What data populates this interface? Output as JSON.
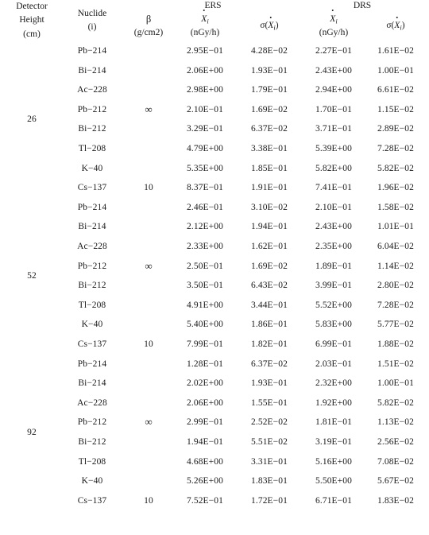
{
  "table": {
    "headers": {
      "detector_height": {
        "line1": "Detector",
        "line2": "Height",
        "line3": "(cm)"
      },
      "nuclide": {
        "line1": "Nuclide",
        "line2": "(i)"
      },
      "group_ers": "ERS",
      "group_drs": "DRS",
      "beta": {
        "symbol": "β",
        "unit": "(g/cm2)"
      },
      "xdot": {
        "var": "X",
        "sub": "i",
        "unit": "(nGy/h)"
      },
      "sigma": {
        "sigma": "σ",
        "open": "(",
        "var": "X",
        "sub": "i",
        "close": ")"
      }
    },
    "columns": [
      "Detector Height (cm)",
      "Nuclide (i)",
      "β (g/cm2)",
      "ERS Ẋi (nGy/h)",
      "ERS σ(Ẋi)",
      "DRS Ẋi (nGy/h)",
      "DRS σ(Ẋi)"
    ],
    "groups": [
      {
        "height": "26",
        "rows": [
          {
            "nuclide": "Pb−214",
            "beta": "",
            "ers_x": "2.95E−01",
            "ers_s": "4.28E−02",
            "drs_x": "2.27E−01",
            "drs_s": "1.61E−02"
          },
          {
            "nuclide": "Bi−214",
            "beta": "",
            "ers_x": "2.06E+00",
            "ers_s": "1.93E−01",
            "drs_x": "2.43E+00",
            "drs_s": "1.00E−01"
          },
          {
            "nuclide": "Ac−228",
            "beta": "",
            "ers_x": "2.98E+00",
            "ers_s": "1.79E−01",
            "drs_x": "2.94E+00",
            "drs_s": "6.61E−02"
          },
          {
            "nuclide": "Pb−212",
            "beta": "∞",
            "ers_x": "2.10E−01",
            "ers_s": "1.69E−02",
            "drs_x": "1.70E−01",
            "drs_s": "1.15E−02"
          },
          {
            "nuclide": "Bi−212",
            "beta": "",
            "ers_x": "3.29E−01",
            "ers_s": "6.37E−02",
            "drs_x": "3.71E−01",
            "drs_s": "2.89E−02"
          },
          {
            "nuclide": "Tl−208",
            "beta": "",
            "ers_x": "4.79E+00",
            "ers_s": "3.38E−01",
            "drs_x": "5.39E+00",
            "drs_s": "7.28E−02"
          },
          {
            "nuclide": "K−40",
            "beta": "",
            "ers_x": "5.35E+00",
            "ers_s": "1.85E−01",
            "drs_x": "5.82E+00",
            "drs_s": "5.82E−02"
          },
          {
            "nuclide": "Cs−137",
            "beta": "10",
            "ers_x": "8.37E−01",
            "ers_s": "1.91E−01",
            "drs_x": "7.41E−01",
            "drs_s": "1.96E−02"
          }
        ]
      },
      {
        "height": "52",
        "rows": [
          {
            "nuclide": "Pb−214",
            "beta": "",
            "ers_x": "2.46E−01",
            "ers_s": "3.10E−02",
            "drs_x": "2.10E−01",
            "drs_s": "1.58E−02"
          },
          {
            "nuclide": "Bi−214",
            "beta": "",
            "ers_x": "2.12E+00",
            "ers_s": "1.94E−01",
            "drs_x": "2.43E+00",
            "drs_s": "1.01E−01"
          },
          {
            "nuclide": "Ac−228",
            "beta": "",
            "ers_x": "2.33E+00",
            "ers_s": "1.62E−01",
            "drs_x": "2.35E+00",
            "drs_s": "6.04E−02"
          },
          {
            "nuclide": "Pb−212",
            "beta": "∞",
            "ers_x": "2.50E−01",
            "ers_s": "1.69E−02",
            "drs_x": "1.89E−01",
            "drs_s": "1.14E−02"
          },
          {
            "nuclide": "Bi−212",
            "beta": "",
            "ers_x": "3.50E−01",
            "ers_s": "6.43E−02",
            "drs_x": "3.99E−01",
            "drs_s": "2.80E−02"
          },
          {
            "nuclide": "Tl−208",
            "beta": "",
            "ers_x": "4.91E+00",
            "ers_s": "3.44E−01",
            "drs_x": "5.52E+00",
            "drs_s": "7.28E−02"
          },
          {
            "nuclide": "K−40",
            "beta": "",
            "ers_x": "5.40E+00",
            "ers_s": "1.86E−01",
            "drs_x": "5.83E+00",
            "drs_s": "5.77E−02"
          },
          {
            "nuclide": "Cs−137",
            "beta": "10",
            "ers_x": "7.99E−01",
            "ers_s": "1.82E−01",
            "drs_x": "6.99E−01",
            "drs_s": "1.88E−02"
          }
        ]
      },
      {
        "height": "92",
        "rows": [
          {
            "nuclide": "Pb−214",
            "beta": "",
            "ers_x": "1.28E−01",
            "ers_s": "6.37E−02",
            "drs_x": "2.03E−01",
            "drs_s": "1.51E−02"
          },
          {
            "nuclide": "Bi−214",
            "beta": "",
            "ers_x": "2.02E+00",
            "ers_s": "1.93E−01",
            "drs_x": "2.32E+00",
            "drs_s": "1.00E−01"
          },
          {
            "nuclide": "Ac−228",
            "beta": "",
            "ers_x": "2.06E+00",
            "ers_s": "1.55E−01",
            "drs_x": "1.92E+00",
            "drs_s": "5.82E−02"
          },
          {
            "nuclide": "Pb−212",
            "beta": "∞",
            "ers_x": "2.99E−01",
            "ers_s": "2.52E−02",
            "drs_x": "1.81E−01",
            "drs_s": "1.13E−02"
          },
          {
            "nuclide": "Bi−212",
            "beta": "",
            "ers_x": "1.94E−01",
            "ers_s": "5.51E−02",
            "drs_x": "3.19E−01",
            "drs_s": "2.56E−02"
          },
          {
            "nuclide": "Tl−208",
            "beta": "",
            "ers_x": "4.68E+00",
            "ers_s": "3.31E−01",
            "drs_x": "5.16E+00",
            "drs_s": "7.08E−02"
          },
          {
            "nuclide": "K−40",
            "beta": "",
            "ers_x": "5.26E+00",
            "ers_s": "1.83E−01",
            "drs_x": "5.50E+00",
            "drs_s": "5.67E−02"
          },
          {
            "nuclide": "Cs−137",
            "beta": "10",
            "ers_x": "7.52E−01",
            "ers_s": "1.72E−01",
            "drs_x": "6.71E−01",
            "drs_s": "1.83E−02"
          }
        ]
      }
    ]
  }
}
